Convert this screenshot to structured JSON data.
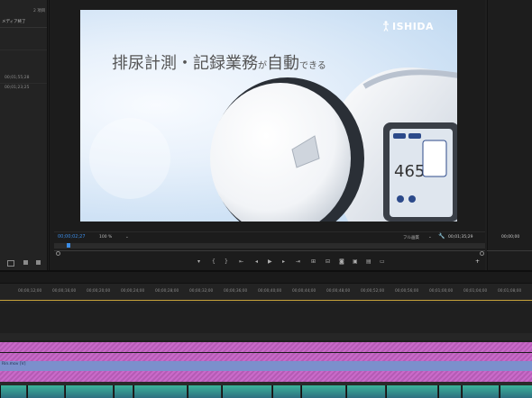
{
  "project_panel": {
    "item_count": "2 項目",
    "menu_label": "メディア終了",
    "durations": [
      "00;01;55;28",
      "00;01;23;25"
    ]
  },
  "program_monitor": {
    "current_timecode": "00;00;02;27",
    "zoom": "100 %",
    "quality": "フル画質",
    "duration": "00;01;35;29",
    "right_timecode": "00;00;00"
  },
  "video_frame": {
    "headline_main": "排尿計測・記録業務",
    "headline_ga": "が",
    "headline_jidou": "自動",
    "headline_end": "できる",
    "brand": "ISHIDA",
    "device_reading": "465"
  },
  "timeline": {
    "ticks": [
      "00;00;12;00",
      "00;00;16;00",
      "00;00;20;00",
      "00;00;24;00",
      "00;00;28;00",
      "00;00;32;00",
      "00;00;36;00",
      "00;00;40;00",
      "00;00;44;00",
      "00;00;48;00",
      "00;00;52;00",
      "00;00;56;00",
      "00;01;00;00",
      "00;01;04;00",
      "00;01;08;00"
    ],
    "blue_clip_label": "Rin.mov [V]"
  },
  "colors": {
    "accent_blue": "#3c8de6",
    "audio_pink": "#c96ac9",
    "video_blue": "#7b90cc",
    "clip_teal": "#3bb39a"
  },
  "icons": [
    "marker-icon",
    "in-point-icon",
    "out-point-icon",
    "go-to-in-icon",
    "step-back-icon",
    "play-icon",
    "step-forward-icon",
    "go-to-out-icon",
    "lift-icon",
    "extract-icon",
    "export-frame-icon",
    "compare-icon",
    "safe-margins-icon",
    "add-button-icon",
    "wrench-icon"
  ]
}
